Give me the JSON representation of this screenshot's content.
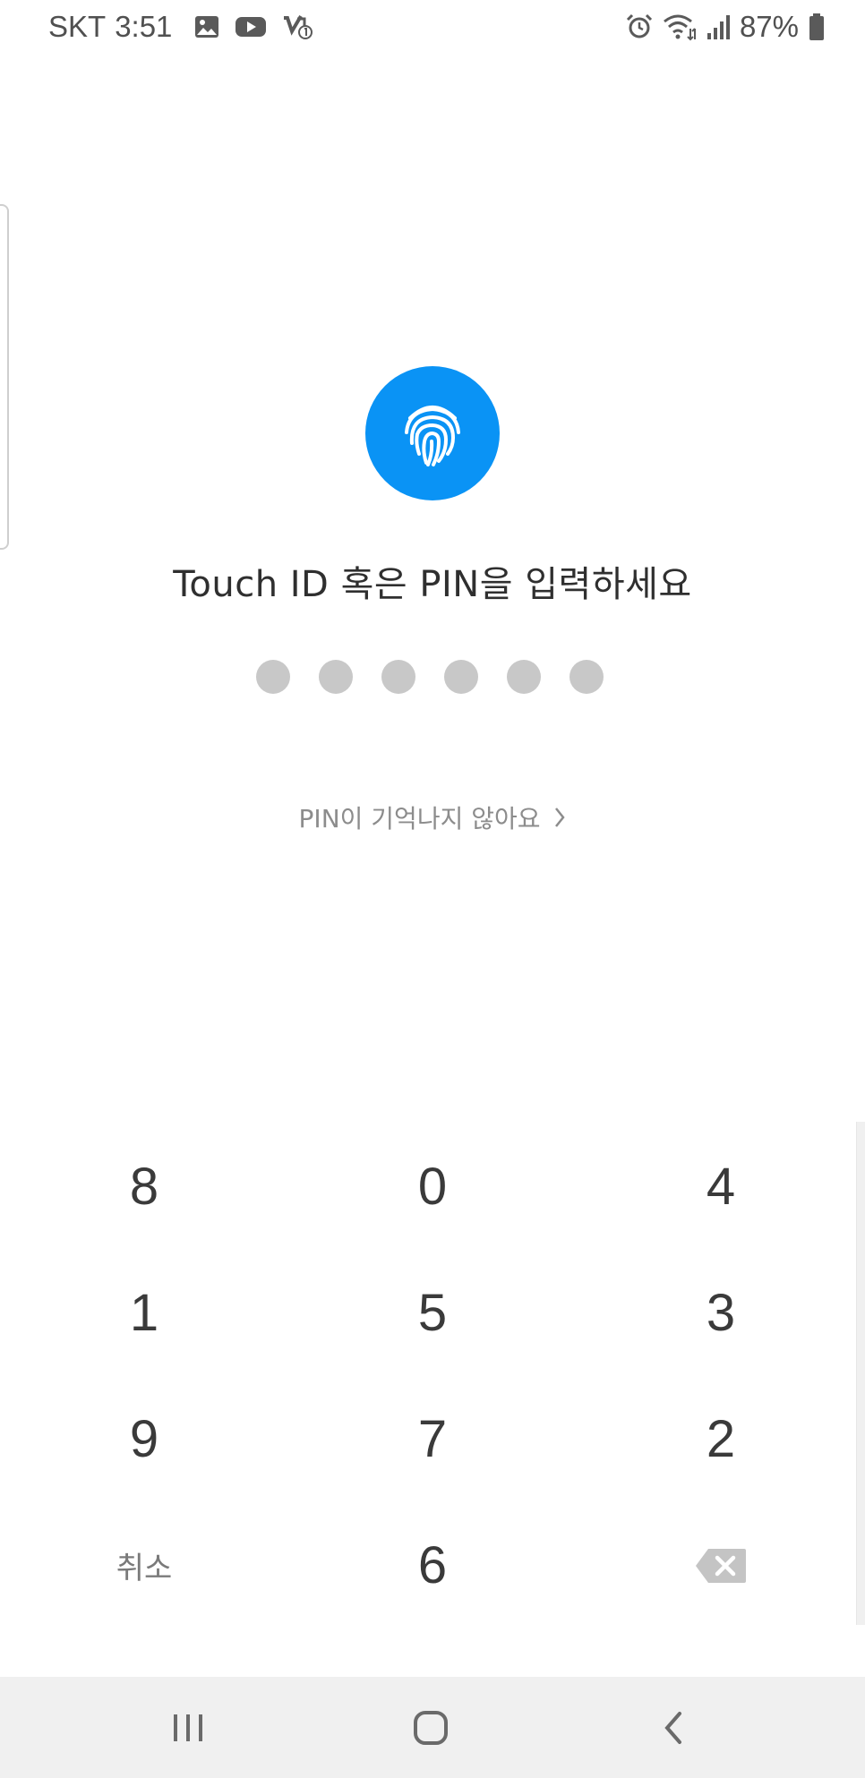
{
  "status_bar": {
    "carrier": "SKT",
    "time": "3:51",
    "battery_percent": "87%",
    "left_icons": [
      "gallery-icon",
      "youtube-icon",
      "missed-call-icon"
    ],
    "right_icons": [
      "alarm-icon",
      "wifi-icon",
      "signal-icon",
      "battery-icon"
    ]
  },
  "auth": {
    "fingerprint_icon": "fingerprint-icon",
    "fingerprint_color": "#0a93f5",
    "prompt": "Touch ID 혹은 PIN을 입력하세요",
    "pin_length": 6,
    "pin_entered": 0,
    "forgot_pin": "PIN이 기억나지 않아요"
  },
  "keypad": {
    "rows": [
      [
        "8",
        "0",
        "4"
      ],
      [
        "1",
        "5",
        "3"
      ],
      [
        "9",
        "7",
        "2"
      ]
    ],
    "cancel_label": "취소",
    "last_digit": "6",
    "backspace_icon": "backspace-icon"
  },
  "nav_bar": {
    "buttons": [
      "recent-apps-icon",
      "home-icon",
      "back-icon"
    ]
  }
}
